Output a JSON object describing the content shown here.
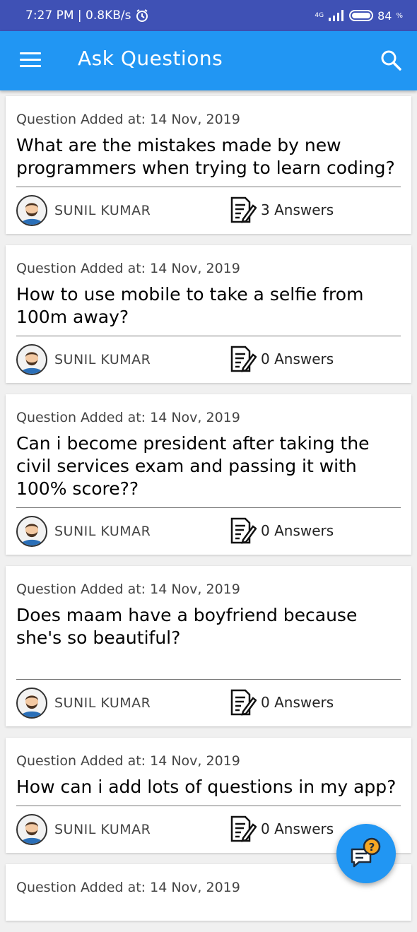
{
  "status_bar": {
    "time_speed": "7:27 PM | 0.8KB/s",
    "network": "4G",
    "battery": "84"
  },
  "app_bar": {
    "title": "Ask Questions",
    "menu_icon": "hamburger-menu-icon",
    "search_icon": "search-icon"
  },
  "questions": [
    {
      "date": "Question Added at: 14 Nov, 2019",
      "text": "What are the mistakes made by new programmers when trying to learn coding?",
      "author": "SUNIL KUMAR",
      "answers": "3 Answers"
    },
    {
      "date": "Question Added at: 14 Nov, 2019",
      "text": "How to use mobile to take a selfie from 100m away?",
      "author": "SUNIL KUMAR",
      "answers": "0 Answers"
    },
    {
      "date": "Question Added at: 14 Nov, 2019",
      "text": "Can i become president after taking the civil services exam and passing it with 100% score??",
      "author": "SUNIL KUMAR",
      "answers": "0 Answers"
    },
    {
      "date": "Question Added at: 14 Nov, 2019",
      "text": "Does maam have a boyfriend because she's so beautiful?",
      "author": "SUNIL KUMAR",
      "answers": "0 Answers"
    },
    {
      "date": "Question Added at: 14 Nov, 2019",
      "text": "How can i add lots of questions in my app?",
      "author": "SUNIL KUMAR",
      "answers": "0 Answers"
    },
    {
      "date": "Question Added at: 14 Nov, 2019",
      "text": "",
      "author": "",
      "answers": ""
    }
  ],
  "fab": {
    "icon": "ask-question-chat-icon",
    "badge": "?"
  },
  "colors": {
    "status_bar": "#3f51b5",
    "app_bar": "#2196f3",
    "fab": "#2196f3",
    "fab_badge": "#f5a623"
  }
}
